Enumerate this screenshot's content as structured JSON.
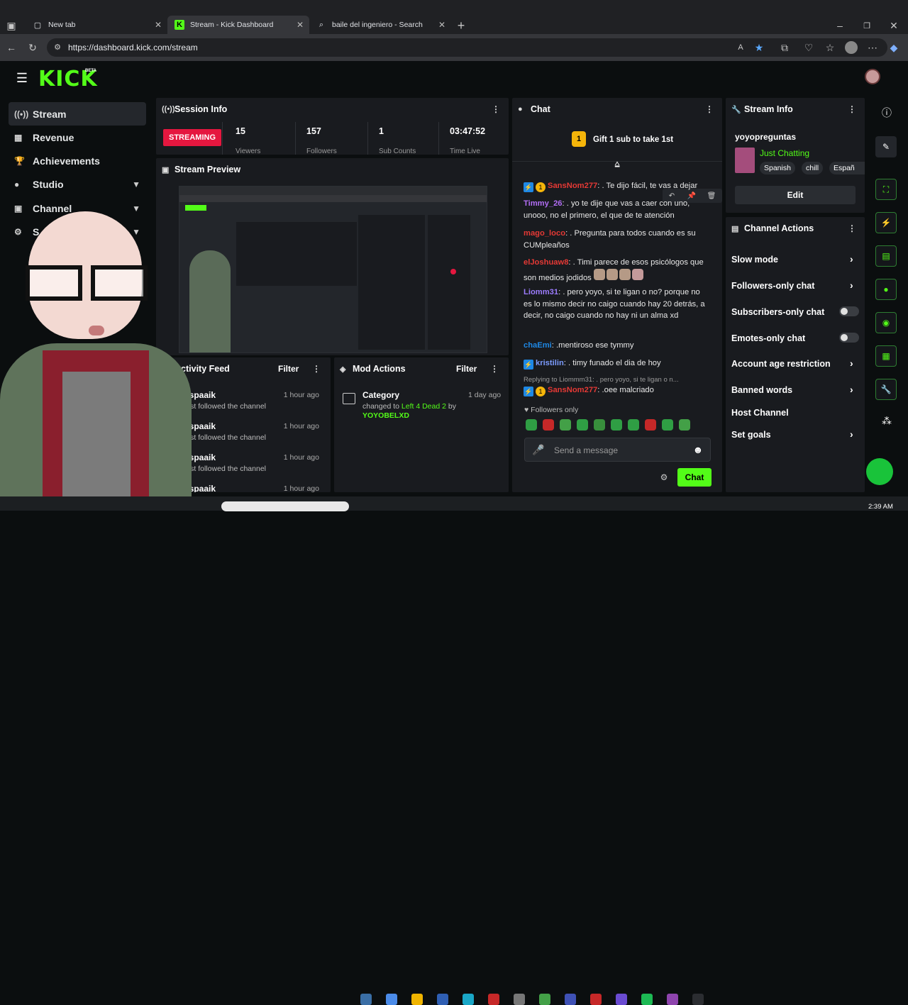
{
  "browser": {
    "tabs": [
      {
        "label": "New tab",
        "icon": "new-tab-icon"
      },
      {
        "label": "Stream - Kick Dashboard",
        "icon": "kick-favicon-icon"
      },
      {
        "label": "baile del ingeniero - Search",
        "icon": "search-icon"
      }
    ],
    "url": "https://dashboard.kick.com/stream"
  },
  "app": {
    "logo": "KICK",
    "logo_badge": "BETA",
    "sidebar": [
      {
        "label": "Stream",
        "icon": "stream-icon"
      },
      {
        "label": "Revenue",
        "icon": "revenue-icon"
      },
      {
        "label": "Achievements",
        "icon": "trophy-icon"
      },
      {
        "label": "Studio",
        "icon": "studio-icon"
      },
      {
        "label": "Channel",
        "icon": "channel-icon"
      },
      {
        "label": "S",
        "icon": "settings-icon"
      }
    ]
  },
  "session": {
    "title": "Session Info",
    "status": "STREAMING",
    "stats": [
      {
        "value": "15",
        "label": "Viewers"
      },
      {
        "value": "157",
        "label": "Followers"
      },
      {
        "value": "1",
        "label": "Sub Counts"
      },
      {
        "value": "03:47:52",
        "label": "Time Live"
      }
    ]
  },
  "preview": {
    "title": "Stream Preview"
  },
  "activity": {
    "title": "Activity Feed",
    "filter": "Filter",
    "items": [
      {
        "user": "sspaaik",
        "text": "just followed the channel",
        "time": "1 hour ago"
      },
      {
        "user": "sspaaik",
        "text": "just followed the channel",
        "time": "1 hour ago"
      },
      {
        "user": "sspaaik",
        "text": "just followed the channel",
        "time": "1 hour ago"
      },
      {
        "user": "sspaaik",
        "text": "",
        "time": "1 hour ago"
      }
    ]
  },
  "mod": {
    "title": "Mod Actions",
    "filter": "Filter",
    "item": {
      "title": "Category",
      "time": "1 day ago",
      "pre": "changed to",
      "game": "Left 4 Dead 2",
      "by": "by",
      "user": "YOYOBELXD"
    }
  },
  "chat": {
    "title": "Chat",
    "gift": "Gift 1 sub to take 1st",
    "messages": [
      {
        "user": "SansNom277",
        "user_color": "#e53935",
        "text": ": . Te dijo fácil, te vas a dejar"
      },
      {
        "user": "Timmy_26",
        "user_color": "#b26ef5",
        "text": ": . yo te dije que vas a caer con uno, unooo, no el primero, el que de te atención"
      },
      {
        "user": "mago_loco",
        "user_color": "#e53935",
        "text": ": . Pregunta para todos cuando es su CUMpleaños"
      },
      {
        "user": "elJoshuaw8",
        "user_color": "#e53935",
        "text": ": . Timi parece de esos psicólogos que son medios jodidos"
      },
      {
        "user": "Liomm31",
        "user_color": "#9c7cff",
        "text": ": . pero yoyo, si te ligan o no? porque no es lo mismo decir no caigo cuando hay 20 detrás, a decir, no caigo cuando no hay ni un alma xd"
      },
      {
        "user": "chaEmi",
        "user_color": "#1e88e5",
        "text": ": .mentiroso ese tymmy"
      },
      {
        "user": "kristilin",
        "user_color": "#7c9cff",
        "text": ": . timy funado el dia de hoy"
      },
      {
        "user": "SansNom277",
        "user_color": "#e53935",
        "text": ": .oee malcriado"
      }
    ],
    "reply": "Replying to Liommm31: . pero yoyo, si te ligan o n...",
    "followers_only": "Followers only",
    "placeholder": "Send a message",
    "send": "Chat"
  },
  "stream_info": {
    "title": "Stream Info",
    "name": "yoyopreguntas",
    "category": "Just Chatting",
    "tags": [
      "Spanish",
      "chill",
      "Españ"
    ],
    "edit": "Edit"
  },
  "channel_actions": {
    "title": "Channel Actions",
    "items": [
      {
        "label": "Slow mode",
        "control": "chevron"
      },
      {
        "label": "Followers-only chat",
        "control": "chevron"
      },
      {
        "label": "Subscribers-only chat",
        "control": "toggle"
      },
      {
        "label": "Emotes-only chat",
        "control": "toggle"
      },
      {
        "label": "Account age restriction",
        "control": "chevron"
      },
      {
        "label": "Banned words",
        "control": "chevron"
      },
      {
        "label": "Host Channel",
        "control": "none"
      },
      {
        "label": "Set goals",
        "control": "chevron"
      }
    ]
  },
  "taskbar": {
    "clock": "2:39 AM"
  },
  "colors": {
    "kick_green": "#53fc18",
    "streaming_red": "#e5173f",
    "panel": "#191b1f"
  }
}
